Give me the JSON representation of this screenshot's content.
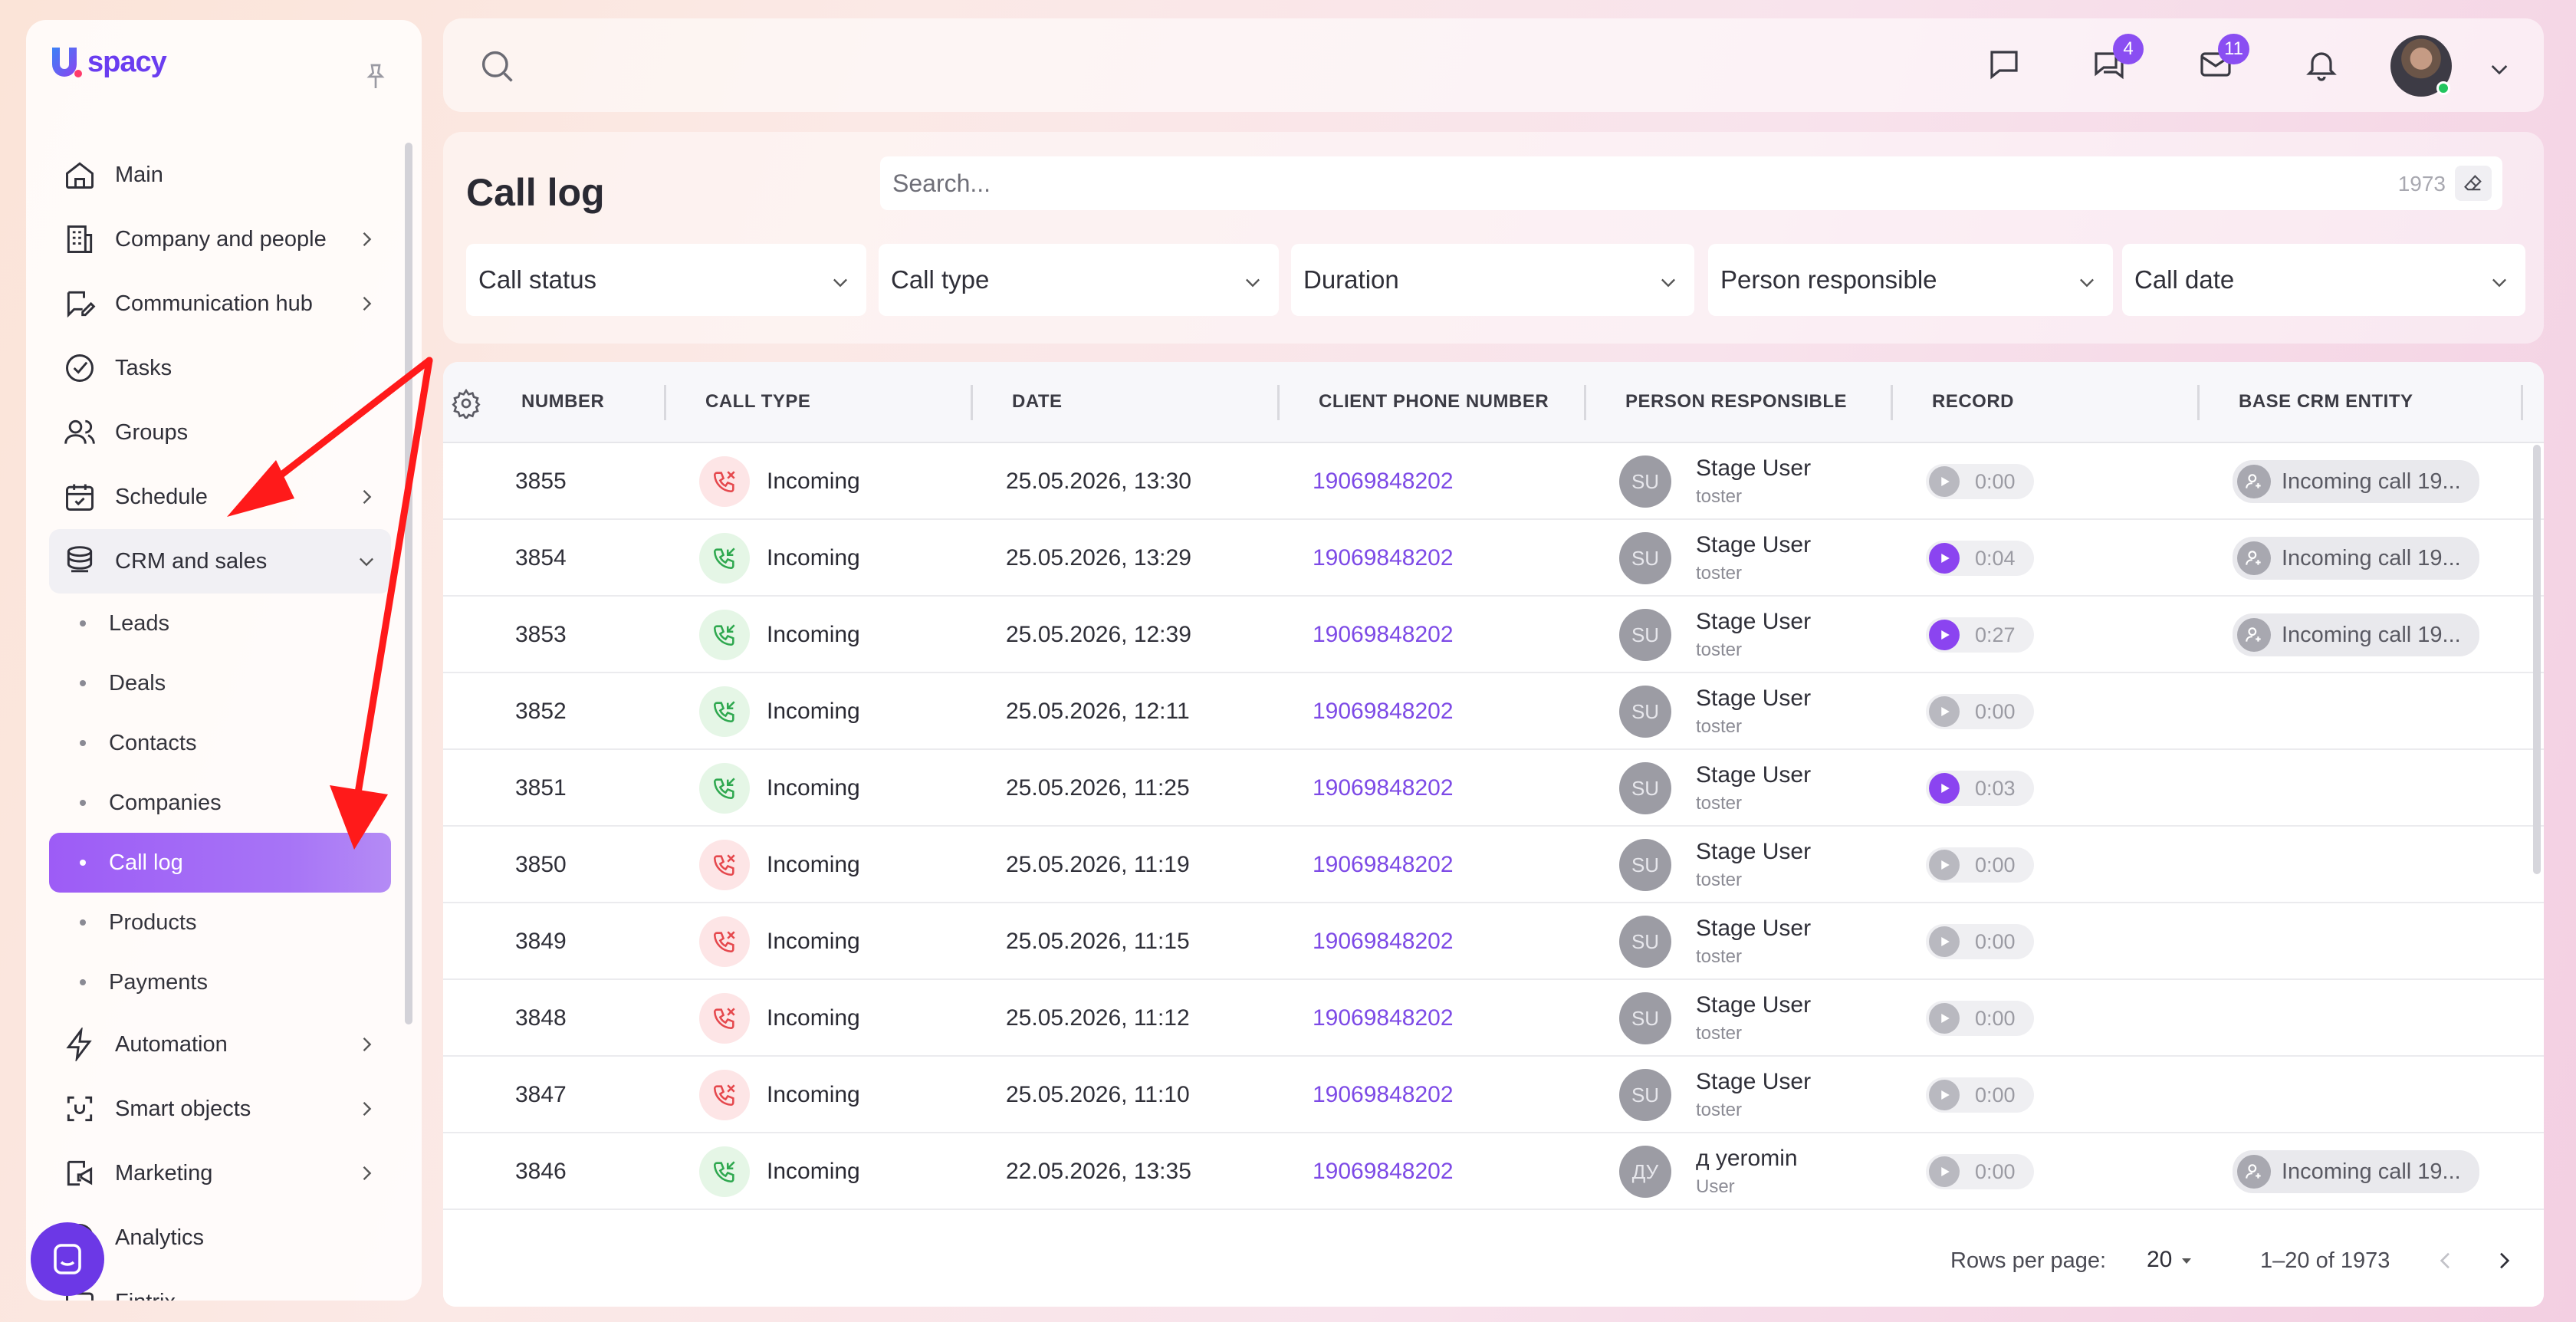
{
  "app": {
    "logo_text": "spacy",
    "logo_letter": "U",
    "accent": "#8b44f0"
  },
  "sidebar": {
    "items": [
      {
        "label": "Main",
        "icon": "home-icon",
        "chevron": false
      },
      {
        "label": "Company and people",
        "icon": "building-icon",
        "chevron": true
      },
      {
        "label": "Communication hub",
        "icon": "chat-edit-icon",
        "chevron": true
      },
      {
        "label": "Tasks",
        "icon": "check-circle-icon",
        "chevron": false
      },
      {
        "label": "Groups",
        "icon": "users-icon",
        "chevron": false
      },
      {
        "label": "Schedule",
        "icon": "calendar-icon",
        "chevron": true
      },
      {
        "label": "CRM and sales",
        "icon": "database-icon",
        "chevron": "down"
      }
    ],
    "crm_sub": [
      "Leads",
      "Deals",
      "Contacts",
      "Companies",
      "Call log",
      "Products",
      "Payments"
    ],
    "crm_active": "Call log",
    "items_after": [
      {
        "label": "Automation",
        "icon": "lightning-icon",
        "chevron": true
      },
      {
        "label": "Smart objects",
        "icon": "scan-icon",
        "chevron": true
      },
      {
        "label": "Marketing",
        "icon": "megaphone-icon",
        "chevron": true
      },
      {
        "label": "Analytics",
        "icon": "chart-icon",
        "chevron": false
      },
      {
        "label": "Fintrix",
        "icon": "finance-icon",
        "chevron": false
      }
    ]
  },
  "topbar": {
    "chat_badge": "4",
    "mail_badge": "11"
  },
  "header": {
    "title": "Call log",
    "search_placeholder": "Search...",
    "total_count": "1973",
    "filters": [
      "Call status",
      "Call type",
      "Duration",
      "Person responsible",
      "Call date"
    ]
  },
  "table": {
    "columns": [
      "NUMBER",
      "CALL TYPE",
      "DATE",
      "CLIENT PHONE NUMBER",
      "PERSON RESPONSIBLE",
      "RECORD",
      "BASE CRM ENTITY"
    ],
    "rows": [
      {
        "number": "3855",
        "type": "Incoming",
        "status": "missed",
        "date": "25.05.2026, 13:30",
        "phone": "19069848202",
        "initials": "SU",
        "person": "Stage User",
        "role": "toster",
        "record": "0:00",
        "has_record": false,
        "crm": "Incoming call 19..."
      },
      {
        "number": "3854",
        "type": "Incoming",
        "status": "answered",
        "date": "25.05.2026, 13:29",
        "phone": "19069848202",
        "initials": "SU",
        "person": "Stage User",
        "role": "toster",
        "record": "0:04",
        "has_record": true,
        "crm": "Incoming call 19..."
      },
      {
        "number": "3853",
        "type": "Incoming",
        "status": "answered",
        "date": "25.05.2026, 12:39",
        "phone": "19069848202",
        "initials": "SU",
        "person": "Stage User",
        "role": "toster",
        "record": "0:27",
        "has_record": true,
        "crm": "Incoming call 19..."
      },
      {
        "number": "3852",
        "type": "Incoming",
        "status": "answered",
        "date": "25.05.2026, 12:11",
        "phone": "19069848202",
        "initials": "SU",
        "person": "Stage User",
        "role": "toster",
        "record": "0:00",
        "has_record": false,
        "crm": ""
      },
      {
        "number": "3851",
        "type": "Incoming",
        "status": "answered",
        "date": "25.05.2026, 11:25",
        "phone": "19069848202",
        "initials": "SU",
        "person": "Stage User",
        "role": "toster",
        "record": "0:03",
        "has_record": true,
        "crm": ""
      },
      {
        "number": "3850",
        "type": "Incoming",
        "status": "missed",
        "date": "25.05.2026, 11:19",
        "phone": "19069848202",
        "initials": "SU",
        "person": "Stage User",
        "role": "toster",
        "record": "0:00",
        "has_record": false,
        "crm": ""
      },
      {
        "number": "3849",
        "type": "Incoming",
        "status": "missed",
        "date": "25.05.2026, 11:15",
        "phone": "19069848202",
        "initials": "SU",
        "person": "Stage User",
        "role": "toster",
        "record": "0:00",
        "has_record": false,
        "crm": ""
      },
      {
        "number": "3848",
        "type": "Incoming",
        "status": "missed",
        "date": "25.05.2026, 11:12",
        "phone": "19069848202",
        "initials": "SU",
        "person": "Stage User",
        "role": "toster",
        "record": "0:00",
        "has_record": false,
        "crm": ""
      },
      {
        "number": "3847",
        "type": "Incoming",
        "status": "missed",
        "date": "25.05.2026, 11:10",
        "phone": "19069848202",
        "initials": "SU",
        "person": "Stage User",
        "role": "toster",
        "record": "0:00",
        "has_record": false,
        "crm": ""
      },
      {
        "number": "3846",
        "type": "Incoming",
        "status": "answered",
        "date": "22.05.2026, 13:35",
        "phone": "19069848202",
        "initials": "ДУ",
        "person": "д yeromin",
        "role": "User",
        "record": "0:00",
        "has_record": false,
        "crm": "Incoming call 19..."
      }
    ]
  },
  "footer": {
    "rows_per_page_label": "Rows per page:",
    "rows_per_page": "20",
    "range": "1–20 of 1973"
  }
}
